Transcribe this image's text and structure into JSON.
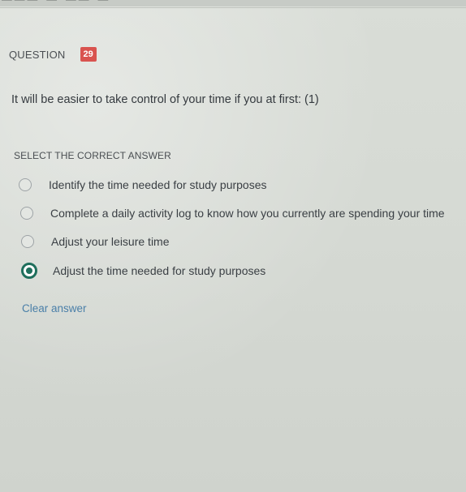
{
  "question": {
    "label": "QUESTION",
    "number": "29",
    "text": "It will be easier to take control of your time if you at first: (1)"
  },
  "instruction": "SELECT THE CORRECT ANSWER",
  "options": [
    {
      "label": "Identify the time needed for study purposes",
      "selected": false
    },
    {
      "label": "Complete a daily activity log to know how you currently are spending your time",
      "selected": false
    },
    {
      "label": "Adjust your leisure time",
      "selected": false
    },
    {
      "label": "Adjust the time needed for study purposes",
      "selected": true
    }
  ],
  "clear_answer_label": "Clear answer",
  "colors": {
    "badge": "#d9534f",
    "selected": "#1f6f5c",
    "link": "#4a7fa8"
  }
}
